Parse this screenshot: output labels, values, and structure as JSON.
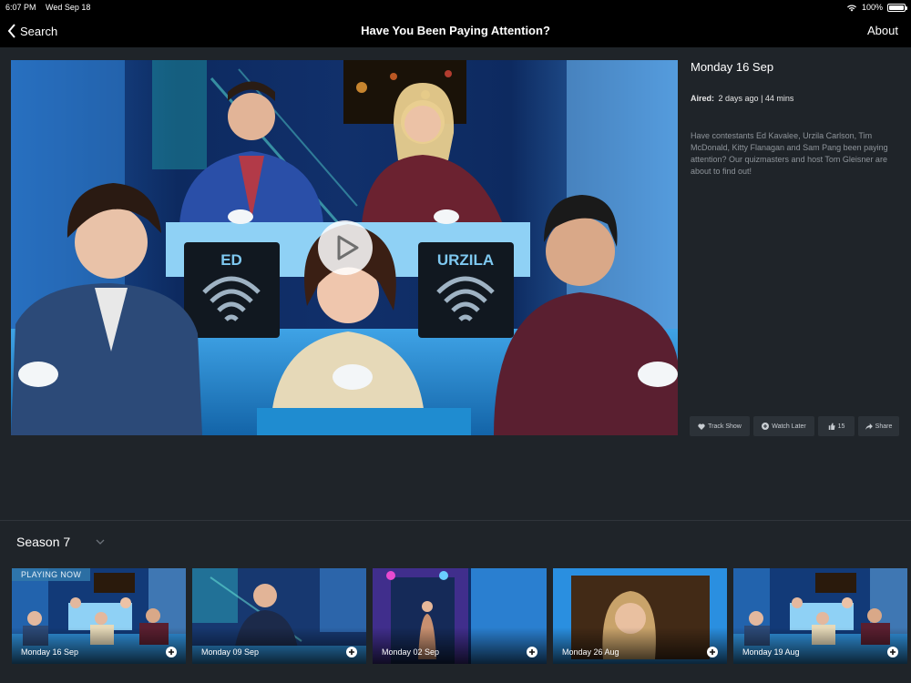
{
  "status_bar": {
    "time": "6:07 PM",
    "date": "Wed Sep 18",
    "battery": "100%"
  },
  "nav": {
    "back_label": "Search",
    "title": "Have You Been Paying Attention?",
    "about_label": "About"
  },
  "hero": {
    "podium_left": "ED",
    "podium_right": "URZILA"
  },
  "episode": {
    "title": "Monday 16 Sep",
    "aired_label": "Aired:",
    "aired_value": "2 days ago | 44 mins",
    "description": "Have contestants Ed Kavalee, Urzila Carlson, Tim McDonald, Kitty Flanagan and Sam Pang been paying attention? Our quizmasters and host Tom Gleisner are about to find out!"
  },
  "actions": {
    "track": "Track Show",
    "watch_later": "Watch Later",
    "likes": "15",
    "share": "Share"
  },
  "season": {
    "label": "Season 7"
  },
  "episodes": [
    {
      "label": "Monday 16 Sep",
      "badge": "PLAYING NOW"
    },
    {
      "label": "Monday 09 Sep"
    },
    {
      "label": "Monday 02 Sep"
    },
    {
      "label": "Monday 26 Aug"
    },
    {
      "label": "Monday 19 Aug"
    }
  ],
  "colors": {
    "background": "#1f2429",
    "bar": "#000000",
    "button": "#2c3238",
    "description": "#8f959b"
  }
}
